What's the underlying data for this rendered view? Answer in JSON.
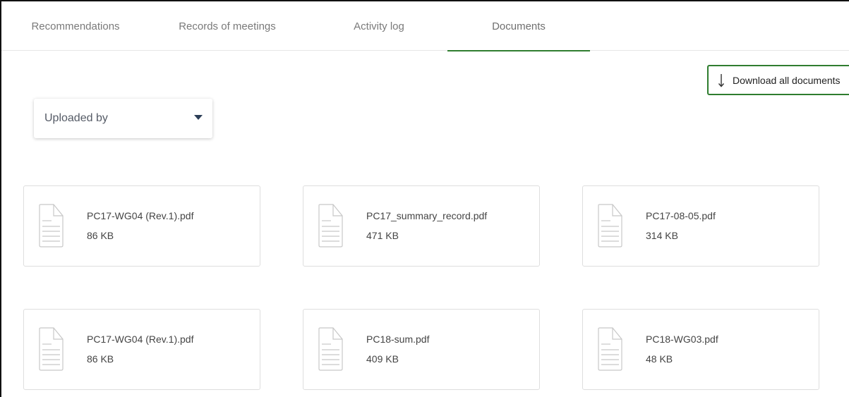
{
  "tabs": [
    {
      "label": "Recommendations",
      "active": false
    },
    {
      "label": "Records of meetings",
      "active": false
    },
    {
      "label": "Activity log",
      "active": false
    },
    {
      "label": "Documents",
      "active": true
    }
  ],
  "actions": {
    "download_all_label": "Download all documents"
  },
  "filter": {
    "label": "Uploaded by"
  },
  "documents": [
    {
      "name": "PC17-WG04 (Rev.1).pdf",
      "size": "86 KB",
      "icon": "document-icon"
    },
    {
      "name": "PC17_summary_record.pdf",
      "size": "471 KB",
      "icon": "document-icon"
    },
    {
      "name": "PC17-08-05.pdf",
      "size": "314 KB",
      "icon": "document-icon"
    },
    {
      "name": "PC17-WG04 (Rev.1).pdf",
      "size": "86 KB",
      "icon": "document-icon"
    },
    {
      "name": "PC18-sum.pdf",
      "size": "409 KB",
      "icon": "document-icon"
    },
    {
      "name": "PC18-WG03.pdf",
      "size": "48 KB",
      "icon": "document-icon"
    }
  ],
  "colors": {
    "accent": "#2f7d2f",
    "tab_text": "#7a7a7a",
    "card_border": "#dedede"
  }
}
